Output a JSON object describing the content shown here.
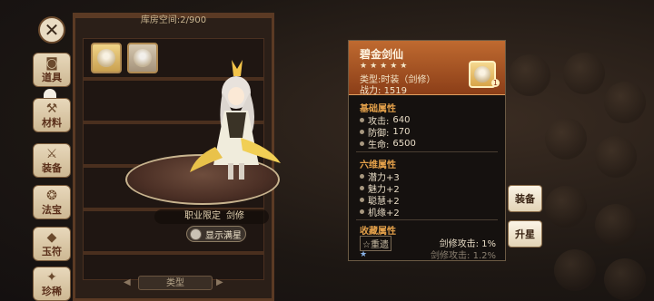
{
  "storage": {
    "label": "库房空间:",
    "value": "2/900"
  },
  "sidebar": {
    "items": [
      {
        "label": "道具",
        "icon": "bag-icon",
        "glyph": "◙"
      },
      {
        "label": "材料",
        "icon": "material-icon",
        "glyph": "⚒"
      },
      {
        "label": "装备",
        "icon": "equipment-icon",
        "glyph": "⚔"
      },
      {
        "label": "法宝",
        "icon": "treasure-icon",
        "glyph": "❂"
      },
      {
        "label": "玉符",
        "icon": "jade-icon",
        "glyph": "◆"
      },
      {
        "label": "珍稀",
        "icon": "rare-icon",
        "glyph": "✦"
      }
    ]
  },
  "display": {
    "career_label": "职业限定",
    "career_value": "剑修",
    "show_full_label": "显示满星",
    "filter_label": "类型"
  },
  "item": {
    "name": "碧金剑仙",
    "stars": "★★★★★",
    "type_label": "类型:",
    "type_value": "时装（剑修）",
    "power_label": "战力:",
    "power_value": "1519",
    "badge": "1"
  },
  "basic": {
    "title": "基础属性",
    "stats": [
      {
        "label": "攻击:",
        "value": "640"
      },
      {
        "label": "防御:",
        "value": "170"
      },
      {
        "label": "生命:",
        "value": "6500"
      }
    ]
  },
  "six": {
    "title": "六维属性",
    "stats": [
      {
        "label": "潜力+3"
      },
      {
        "label": "魅力+2"
      },
      {
        "label": "聪慧+2"
      },
      {
        "label": "机缘+2"
      }
    ]
  },
  "collection": {
    "title": "收藏属性",
    "tag": "☆重遗",
    "bonus1": "剑修攻击: 1%",
    "bonus2": "剑修攻击: 1.2%",
    "star": "★"
  },
  "buttons": {
    "equip": "装备",
    "upgrade": "升星"
  },
  "colors": {
    "header": "#bf6a30",
    "accent": "#e3a04a",
    "panel": "#15110f"
  }
}
